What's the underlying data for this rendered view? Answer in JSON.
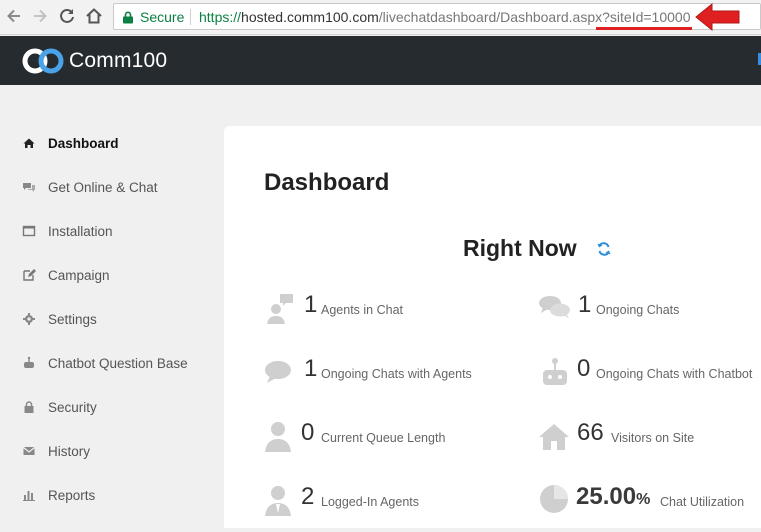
{
  "browser": {
    "secure_label": "Secure",
    "url_scheme": "https://",
    "url_host": "hosted.comm100.com",
    "url_path": "/livechatdashboard/Dashboard.aspx?siteId=10000",
    "annotation_color": "#e02020"
  },
  "header": {
    "brand": "Comm100",
    "background": "#262b30"
  },
  "sidebar": {
    "items": [
      {
        "label": "Dashboard",
        "icon": "home-icon",
        "active": true
      },
      {
        "label": "Get Online & Chat",
        "icon": "chat-bubbles-icon"
      },
      {
        "label": "Installation",
        "icon": "window-icon"
      },
      {
        "label": "Campaign",
        "icon": "edit-icon"
      },
      {
        "label": "Settings",
        "icon": "gear-icon"
      },
      {
        "label": "Chatbot Question Base",
        "icon": "chatbot-icon"
      },
      {
        "label": "Security",
        "icon": "lock-icon"
      },
      {
        "label": "History",
        "icon": "envelope-icon"
      },
      {
        "label": "Reports",
        "icon": "bar-chart-icon"
      }
    ]
  },
  "main": {
    "title": "Dashboard",
    "section_title": "Right Now",
    "stats": [
      {
        "value": "1",
        "label": "Agents in Chat",
        "icon": "agents-chat-icon"
      },
      {
        "value": "1",
        "label": "Ongoing Chats",
        "icon": "chat-bubbles-icon"
      },
      {
        "value": "1",
        "label": "Ongoing Chats with Agents",
        "icon": "speech-bubble-icon"
      },
      {
        "value": "0",
        "label": "Ongoing Chats with Chatbot",
        "icon": "chatbot-icon"
      },
      {
        "value": "0",
        "label": "Current Queue Length",
        "icon": "person-icon"
      },
      {
        "value": "66",
        "label": "Visitors on Site",
        "icon": "house-icon"
      },
      {
        "value": "2",
        "label": "Logged-In Agents",
        "icon": "agent-icon"
      },
      {
        "value": "25.00",
        "unit": "%",
        "label": "Chat Utilization",
        "icon": "pie-icon"
      }
    ]
  }
}
